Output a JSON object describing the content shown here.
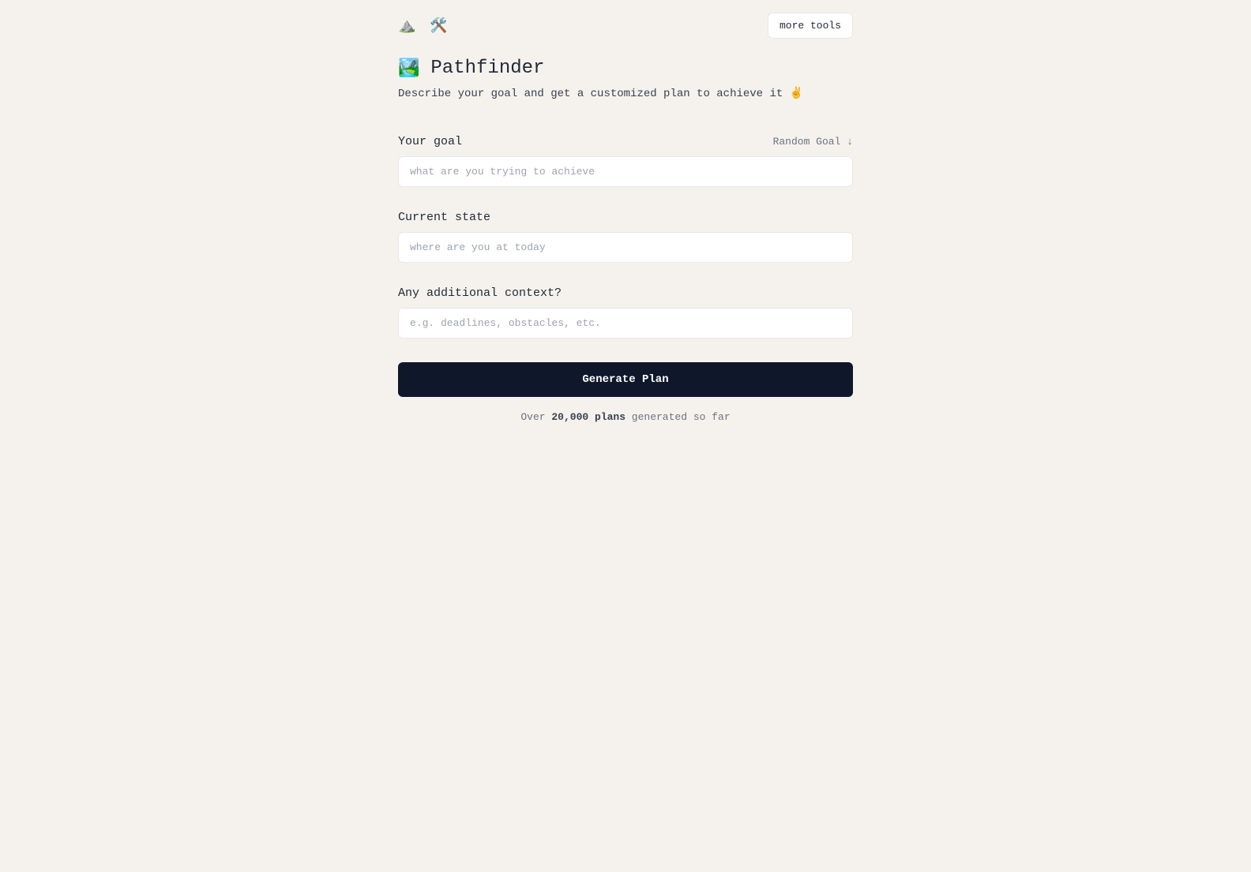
{
  "header": {
    "icon1": "⛰️",
    "icon2": "🛠️",
    "more_tools_label": "more tools"
  },
  "title": {
    "icon": "🏞️",
    "text": "Pathfinder"
  },
  "subtitle": {
    "text": "Describe your goal and get a customized plan to achieve it ",
    "icon": "✌️"
  },
  "fields": {
    "goal": {
      "label": "Your goal",
      "random_label": "Random Goal ↓",
      "placeholder": "what are you trying to achieve",
      "value": ""
    },
    "current_state": {
      "label": "Current state",
      "placeholder": "where are you at today",
      "value": ""
    },
    "context": {
      "label": "Any additional context?",
      "placeholder": "e.g. deadlines, obstacles, etc.",
      "value": ""
    }
  },
  "generate_button_label": "Generate Plan",
  "stats": {
    "prefix": "Over ",
    "bold": "20,000 plans",
    "suffix": " generated so far"
  }
}
